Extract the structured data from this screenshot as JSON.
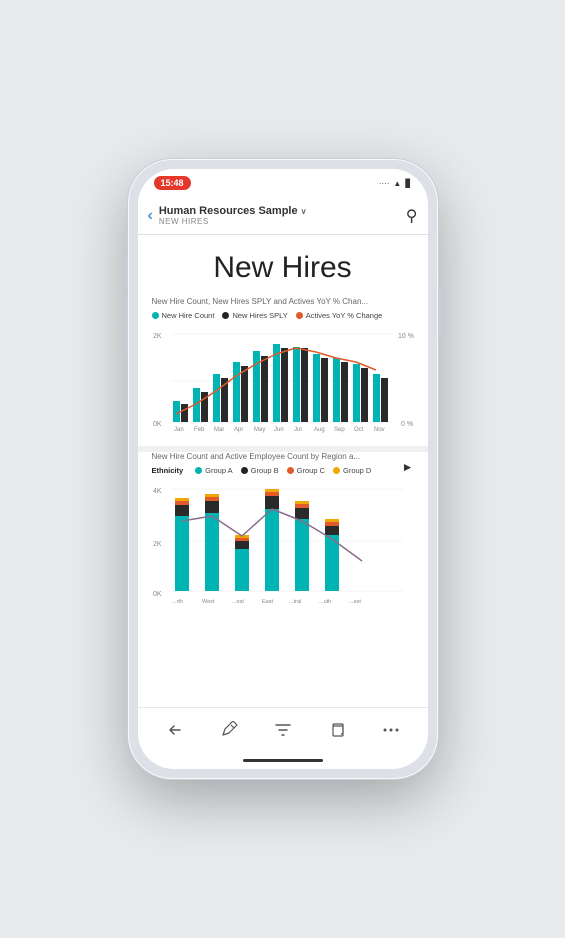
{
  "status": {
    "time": "15:48",
    "icons": ".... ▲ 🔋"
  },
  "nav": {
    "back_label": "<",
    "title_main": "Human Resources Sample",
    "title_sub": "NEW HIRES",
    "chevron": "∨"
  },
  "page": {
    "title": "New Hires"
  },
  "chart1": {
    "label": "New Hire Count, New Hires SPLY and Actives YoY % Chan...",
    "legend": [
      {
        "name": "New Hire Count",
        "color": "#00b4b4"
      },
      {
        "name": "New Hires SPLY",
        "color": "#222"
      },
      {
        "name": "Actives YoY % Change",
        "color": "#e05a2b"
      }
    ],
    "y_left": [
      "2K",
      "0K"
    ],
    "y_right": [
      "10 %",
      "0 %"
    ],
    "x_labels": [
      "Jan",
      "Feb",
      "Mar",
      "Apr",
      "May",
      "Jun",
      "Jul",
      "Aug",
      "Sep",
      "Oct",
      "Nov"
    ],
    "bars_teal": [
      20,
      35,
      55,
      75,
      90,
      100,
      95,
      85,
      80,
      70,
      55
    ],
    "bars_dark": [
      15,
      30,
      48,
      65,
      80,
      88,
      90,
      78,
      72,
      65,
      50
    ],
    "line_points": [
      10,
      18,
      28,
      42,
      55,
      65,
      72,
      68,
      62,
      58,
      50
    ]
  },
  "chart2": {
    "label": "New Hire Count and Active Employee Count by Region a...",
    "ethnicity_label": "Ethnicity",
    "legend": [
      {
        "name": "Group A",
        "color": "#00b4b4"
      },
      {
        "name": "Group B",
        "color": "#222"
      },
      {
        "name": "Group C",
        "color": "#e05a2b"
      },
      {
        "name": "Group D",
        "color": "#f0a800"
      }
    ],
    "y_labels": [
      "4K",
      "2K",
      "0K"
    ],
    "x_labels": [
      "North",
      "West",
      "West",
      "East",
      "Central",
      "South",
      "West"
    ],
    "stacked_bars": [
      {
        "teal": 80,
        "dark": 30,
        "red": 8,
        "yellow": 5
      },
      {
        "teal": 85,
        "dark": 32,
        "red": 7,
        "yellow": 4
      },
      {
        "teal": 40,
        "dark": 15,
        "red": 5,
        "yellow": 3
      },
      {
        "teal": 88,
        "dark": 35,
        "red": 9,
        "yellow": 5
      },
      {
        "teal": 75,
        "dark": 28,
        "red": 7,
        "yellow": 4
      },
      {
        "teal": 50,
        "dark": 20,
        "red": 6,
        "yellow": 4
      },
      {
        "teal": 0,
        "dark": 0,
        "red": 0,
        "yellow": 0
      }
    ],
    "line_points": [
      65,
      70,
      45,
      72,
      58,
      40,
      30
    ]
  },
  "toolbar": {
    "back_label": "↩",
    "edit_label": "✂",
    "filter_label": "⊿",
    "copy_label": "⧉",
    "more_label": "…"
  },
  "colors": {
    "teal": "#00b4b4",
    "dark": "#2a2a2a",
    "orange": "#e05a2b",
    "yellow": "#f0a800",
    "line_purple": "#8b6b8b"
  }
}
